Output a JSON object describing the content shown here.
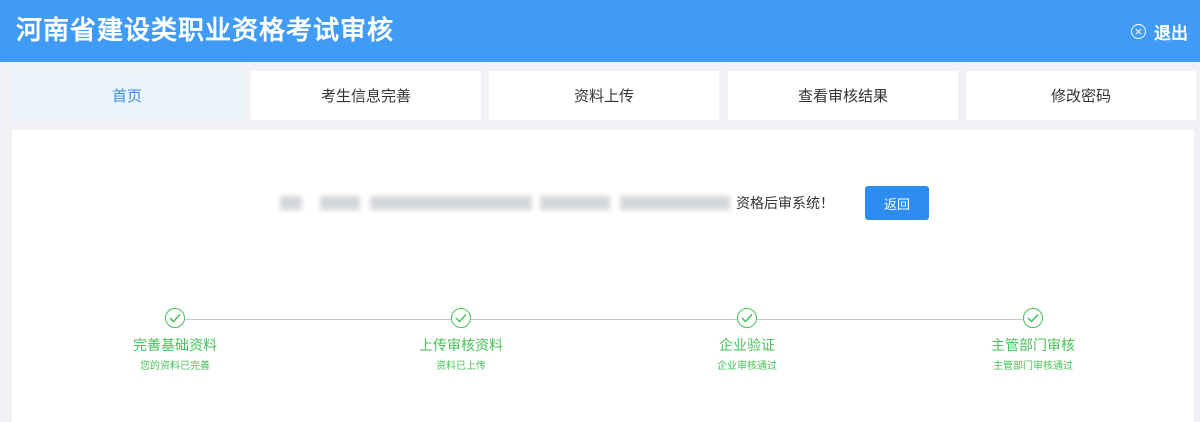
{
  "header": {
    "title": "河南省建设类职业资格考试审核",
    "logout_icon": "close-circle-icon",
    "logout_label": "退出"
  },
  "nav": {
    "tabs": [
      {
        "label": "首页",
        "active": true
      },
      {
        "label": "考生信息完善",
        "active": false
      },
      {
        "label": "资料上传",
        "active": false
      },
      {
        "label": "查看审核结果",
        "active": false
      },
      {
        "label": "修改密码",
        "active": false
      }
    ]
  },
  "main": {
    "message_suffix": "资格后审系统！",
    "back_button": "返回",
    "steps": [
      {
        "label": "完善基础资料",
        "status": "您的资料已完善",
        "icon": "check-icon"
      },
      {
        "label": "上传审核资料",
        "status": "资料已上传",
        "icon": "check-icon"
      },
      {
        "label": "企业验证",
        "status": "企业审核通过",
        "icon": "check-icon"
      },
      {
        "label": "主管部门审核",
        "status": "主管部门审核通过",
        "icon": "check-icon"
      }
    ]
  },
  "colors": {
    "header_bg": "#3f9bf5",
    "active_tab_text": "#3a8ee6",
    "primary_button": "#2d8cf0",
    "step_success": "#47c15a"
  }
}
